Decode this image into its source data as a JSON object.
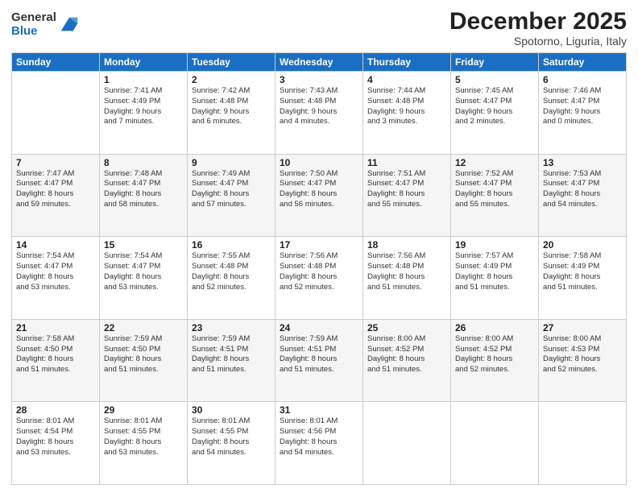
{
  "logo": {
    "general": "General",
    "blue": "Blue"
  },
  "header": {
    "month": "December 2025",
    "location": "Spotorno, Liguria, Italy"
  },
  "days_of_week": [
    "Sunday",
    "Monday",
    "Tuesday",
    "Wednesday",
    "Thursday",
    "Friday",
    "Saturday"
  ],
  "weeks": [
    [
      {
        "day": "",
        "info": ""
      },
      {
        "day": "1",
        "info": "Sunrise: 7:41 AM\nSunset: 4:49 PM\nDaylight: 9 hours\nand 7 minutes."
      },
      {
        "day": "2",
        "info": "Sunrise: 7:42 AM\nSunset: 4:48 PM\nDaylight: 9 hours\nand 6 minutes."
      },
      {
        "day": "3",
        "info": "Sunrise: 7:43 AM\nSunset: 4:48 PM\nDaylight: 9 hours\nand 4 minutes."
      },
      {
        "day": "4",
        "info": "Sunrise: 7:44 AM\nSunset: 4:48 PM\nDaylight: 9 hours\nand 3 minutes."
      },
      {
        "day": "5",
        "info": "Sunrise: 7:45 AM\nSunset: 4:47 PM\nDaylight: 9 hours\nand 2 minutes."
      },
      {
        "day": "6",
        "info": "Sunrise: 7:46 AM\nSunset: 4:47 PM\nDaylight: 9 hours\nand 0 minutes."
      }
    ],
    [
      {
        "day": "7",
        "info": "Sunrise: 7:47 AM\nSunset: 4:47 PM\nDaylight: 8 hours\nand 59 minutes."
      },
      {
        "day": "8",
        "info": "Sunrise: 7:48 AM\nSunset: 4:47 PM\nDaylight: 8 hours\nand 58 minutes."
      },
      {
        "day": "9",
        "info": "Sunrise: 7:49 AM\nSunset: 4:47 PM\nDaylight: 8 hours\nand 57 minutes."
      },
      {
        "day": "10",
        "info": "Sunrise: 7:50 AM\nSunset: 4:47 PM\nDaylight: 8 hours\nand 56 minutes."
      },
      {
        "day": "11",
        "info": "Sunrise: 7:51 AM\nSunset: 4:47 PM\nDaylight: 8 hours\nand 55 minutes."
      },
      {
        "day": "12",
        "info": "Sunrise: 7:52 AM\nSunset: 4:47 PM\nDaylight: 8 hours\nand 55 minutes."
      },
      {
        "day": "13",
        "info": "Sunrise: 7:53 AM\nSunset: 4:47 PM\nDaylight: 8 hours\nand 54 minutes."
      }
    ],
    [
      {
        "day": "14",
        "info": "Sunrise: 7:54 AM\nSunset: 4:47 PM\nDaylight: 8 hours\nand 53 minutes."
      },
      {
        "day": "15",
        "info": "Sunrise: 7:54 AM\nSunset: 4:47 PM\nDaylight: 8 hours\nand 53 minutes."
      },
      {
        "day": "16",
        "info": "Sunrise: 7:55 AM\nSunset: 4:48 PM\nDaylight: 8 hours\nand 52 minutes."
      },
      {
        "day": "17",
        "info": "Sunrise: 7:56 AM\nSunset: 4:48 PM\nDaylight: 8 hours\nand 52 minutes."
      },
      {
        "day": "18",
        "info": "Sunrise: 7:56 AM\nSunset: 4:48 PM\nDaylight: 8 hours\nand 51 minutes."
      },
      {
        "day": "19",
        "info": "Sunrise: 7:57 AM\nSunset: 4:49 PM\nDaylight: 8 hours\nand 51 minutes."
      },
      {
        "day": "20",
        "info": "Sunrise: 7:58 AM\nSunset: 4:49 PM\nDaylight: 8 hours\nand 51 minutes."
      }
    ],
    [
      {
        "day": "21",
        "info": "Sunrise: 7:58 AM\nSunset: 4:50 PM\nDaylight: 8 hours\nand 51 minutes."
      },
      {
        "day": "22",
        "info": "Sunrise: 7:59 AM\nSunset: 4:50 PM\nDaylight: 8 hours\nand 51 minutes."
      },
      {
        "day": "23",
        "info": "Sunrise: 7:59 AM\nSunset: 4:51 PM\nDaylight: 8 hours\nand 51 minutes."
      },
      {
        "day": "24",
        "info": "Sunrise: 7:59 AM\nSunset: 4:51 PM\nDaylight: 8 hours\nand 51 minutes."
      },
      {
        "day": "25",
        "info": "Sunrise: 8:00 AM\nSunset: 4:52 PM\nDaylight: 8 hours\nand 51 minutes."
      },
      {
        "day": "26",
        "info": "Sunrise: 8:00 AM\nSunset: 4:52 PM\nDaylight: 8 hours\nand 52 minutes."
      },
      {
        "day": "27",
        "info": "Sunrise: 8:00 AM\nSunset: 4:53 PM\nDaylight: 8 hours\nand 52 minutes."
      }
    ],
    [
      {
        "day": "28",
        "info": "Sunrise: 8:01 AM\nSunset: 4:54 PM\nDaylight: 8 hours\nand 53 minutes."
      },
      {
        "day": "29",
        "info": "Sunrise: 8:01 AM\nSunset: 4:55 PM\nDaylight: 8 hours\nand 53 minutes."
      },
      {
        "day": "30",
        "info": "Sunrise: 8:01 AM\nSunset: 4:55 PM\nDaylight: 8 hours\nand 54 minutes."
      },
      {
        "day": "31",
        "info": "Sunrise: 8:01 AM\nSunset: 4:56 PM\nDaylight: 8 hours\nand 54 minutes."
      },
      {
        "day": "",
        "info": ""
      },
      {
        "day": "",
        "info": ""
      },
      {
        "day": "",
        "info": ""
      }
    ]
  ]
}
